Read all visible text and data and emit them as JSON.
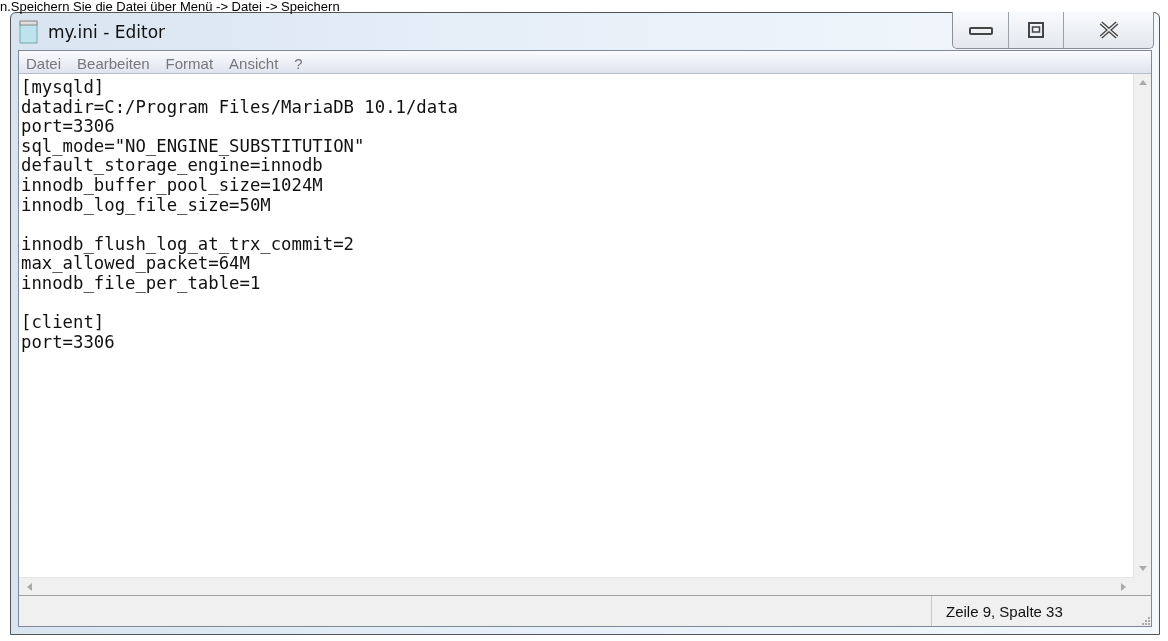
{
  "caption": "n.Speichern Sie die Datei über Menü -> Datei -> Speichern",
  "window": {
    "title": "my.ini - Editor"
  },
  "menu": [
    "Datei",
    "Bearbeiten",
    "Format",
    "Ansicht",
    "?"
  ],
  "editor": {
    "blocks": [
      [
        "[mysqld]",
        "datadir=C:/Program Files/MariaDB 10.1/data",
        "port=3306",
        "sql_mode=\"NO_ENGINE_SUBSTITUTION\"",
        "default_storage_engine=innodb",
        "innodb_buffer_pool_size=1024M",
        "innodb_log_file_size=50M"
      ],
      [
        "innodb_flush_log_at_trx_commit=2",
        "max_allowed_packet=64M",
        "innodb_file_per_table=1"
      ],
      [
        "[client]",
        "port=3306"
      ]
    ]
  },
  "status_bar": {
    "position": "Zeile 9, Spalte 33"
  }
}
